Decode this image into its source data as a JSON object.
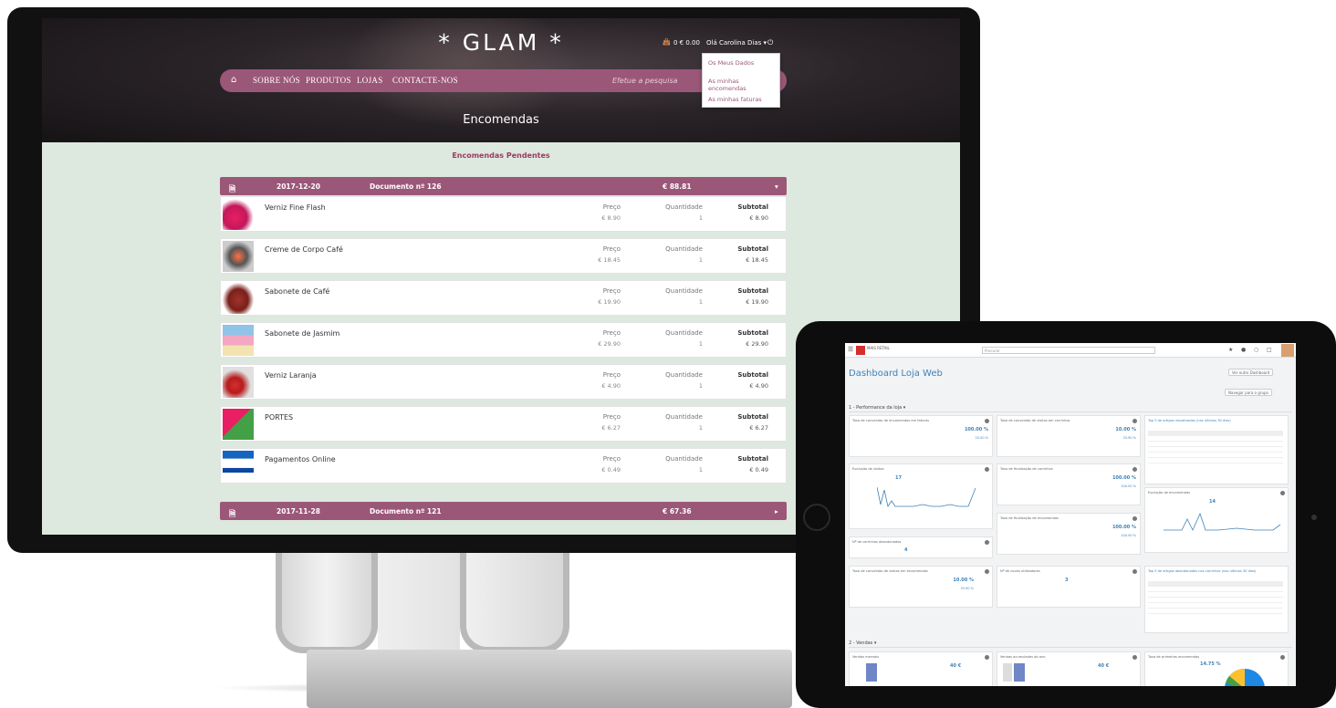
{
  "store": {
    "logo": "* GLAM *",
    "cart_amount": "0  € 0.00",
    "greeting": "Olá Carolina Dias ▾",
    "power_icon": "power-icon",
    "nav": [
      "SOBRE NÓS",
      "PRODUTOS",
      "LOJAS",
      "CONTACTE-NOS"
    ],
    "home_icon": "home-icon",
    "search_placeholder": "Efetue a pesquisa",
    "user_menu": [
      "Os Meus Dados",
      "As minhas encomendas",
      "As minhas faturas"
    ],
    "page_title": "Encomendas",
    "section_title": "Encomendas Pendentes",
    "orders": [
      {
        "date": "2017-12-20",
        "doc": "Documento nº 126",
        "total": "€ 88.81",
        "toggle": "▾"
      },
      {
        "date": "2017-11-28",
        "doc": "Documento nº 121",
        "total": "€ 67.36",
        "toggle": "▸"
      }
    ],
    "labels": {
      "price": "Preço",
      "qty": "Quantidade",
      "subtotal": "Subtotal"
    },
    "items": [
      {
        "name": "Verniz Fine Flash",
        "price": "€ 8.90",
        "qty": "1",
        "subtotal": "€ 8.90"
      },
      {
        "name": "Creme de Corpo Café",
        "price": "€ 18.45",
        "qty": "1",
        "subtotal": "€ 18.45"
      },
      {
        "name": "Sabonete de Café",
        "price": "€ 19.90",
        "qty": "1",
        "subtotal": "€ 19.90"
      },
      {
        "name": "Sabonete de Jasmim",
        "price": "€ 29.90",
        "qty": "1",
        "subtotal": "€ 29.90"
      },
      {
        "name": "Verniz Laranja",
        "price": "€ 4.90",
        "qty": "1",
        "subtotal": "€ 4.90"
      },
      {
        "name": "PORTES",
        "price": "€ 6.27",
        "qty": "1",
        "subtotal": "€ 6.27"
      },
      {
        "name": "Pagamentos Online",
        "price": "€ 0.49",
        "qty": "1",
        "subtotal": "€ 0.49"
      }
    ]
  },
  "dashboard": {
    "title": "Dashboard Loja Web",
    "brand": "MAIS\nRETAIL",
    "search_placeholder": "Procurar",
    "btn_new": "Ver outro Dashboard",
    "btn_manage": "Navegar para o grupo",
    "section1": "1 - Performance da loja ▾",
    "section2": "2 - Vendas ▾",
    "cards": {
      "conv_cart": {
        "title": "Taxa de conversão de encomendas em faturas",
        "value": "100.00 %",
        "sub": "20.00 %"
      },
      "conv_visits": {
        "title": "Taxa de conversão de visitas em carrinhos",
        "value": "10.00 %",
        "sub": "33.90 %"
      },
      "top_items": {
        "title": "Top 5 de artigos visualizados (nos últimos 30 dias)"
      },
      "evol_visits": {
        "title": "Evolução de visitas",
        "value": "17"
      },
      "final_cart": {
        "title": "Taxa de finalização de carrinhos",
        "value": "100.00 %",
        "sub": "100.00 %"
      },
      "evol_orders": {
        "title": "Evolução de encomendas",
        "value": "14"
      },
      "final_orders": {
        "title": "Taxa de finalização de encomendas",
        "value": "100.00 %",
        "sub": "100.00 %"
      },
      "abandoned": {
        "title": "Nº de carrinhos abandonados",
        "value": "4"
      },
      "conv_orders": {
        "title": "Taxa de conversão de visitas em encomendas",
        "value": "10.00 %",
        "sub": "33.90 %"
      },
      "new_users": {
        "title": "Nº de novos utilizadores",
        "value": "3"
      },
      "top_abandoned": {
        "title": "Top 5 de artigos abandonados nos carrinhos (nos últimos 30 dias)"
      },
      "sales_month": {
        "title": "Vendas mensais",
        "value": "40 €"
      },
      "sales_year": {
        "title": "Vendas acumuladas do ano",
        "value": "40 €"
      },
      "first_orders": {
        "title": "Taxa de primeiras encomendas",
        "value": "14.75 %"
      }
    }
  }
}
